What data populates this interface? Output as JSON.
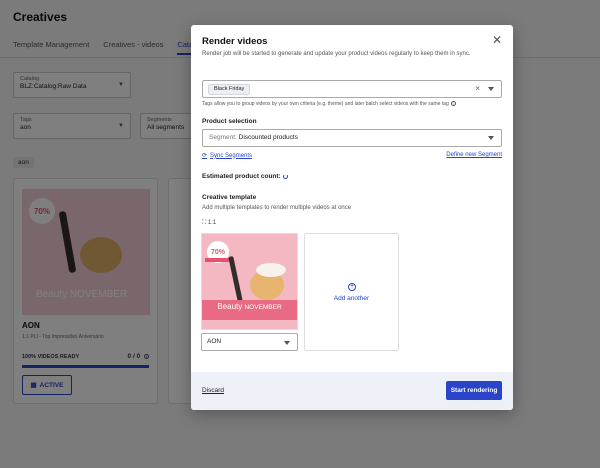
{
  "background": {
    "title": "Creatives",
    "tabs": [
      "Template Management",
      "Creatives - videos",
      "Cata"
    ],
    "catalog": {
      "label": "Catalog",
      "value": "BLZ:Catalog:Raw Data"
    },
    "tags": {
      "label": "Tags",
      "value": "aon"
    },
    "segments": {
      "label": "Segments",
      "value": "All segments"
    },
    "chip": "aon",
    "card": {
      "badge": "70%",
      "beauty": "Beauty NOVEMBER",
      "name": "AON",
      "meta": "1:1  PLI - Top Impressões Aniversário",
      "ready": "100% VIDEOS READY",
      "count": "0 / 0",
      "active": "ACTIVE",
      "progress": 1.0
    }
  },
  "modal": {
    "title": "Render videos",
    "subtitle": "Render job will be started to generate and update your product videos regularly to keep them in sync.",
    "tag_chip": "Black Friday",
    "tag_help": "Tags allow you to group videos by your own criteria (e.g. theme) and later batch select videos with the same tag",
    "product_selection_label": "Product selection",
    "segment_prefix": "Segment:",
    "segment_value": "Discounted products",
    "sync_segments": "Sync Segments",
    "define_segment": "Define new Segment",
    "estimated_label": "Estimated product count:",
    "creative_template_label": "Creative template",
    "creative_template_help": "Add multiple templates to render multiple videos at once",
    "ratio": "1:1",
    "template": {
      "badge": "70%",
      "beauty": "Beauty",
      "month": "NOVEMBER",
      "select_value": "AON"
    },
    "add_another": "Add another",
    "discard": "Discard",
    "start": "Start rendering"
  },
  "colors": {
    "accent": "#2a44c9",
    "footer": "#eef0f8",
    "template_bg": "#f3b8c2"
  }
}
